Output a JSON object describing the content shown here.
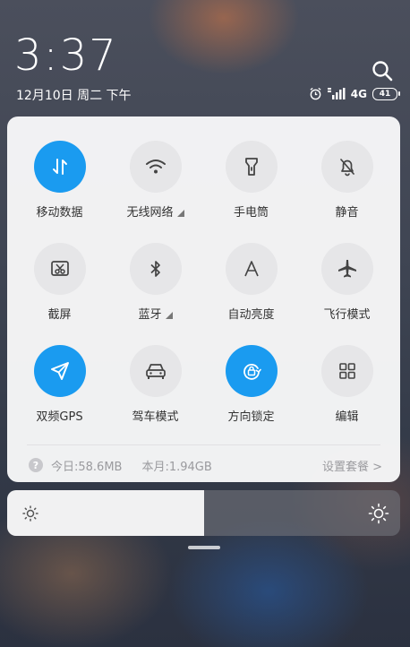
{
  "status": {
    "time": "3:37",
    "date": "12月10日 周二 下午",
    "network": "4G",
    "battery": "41"
  },
  "tiles": [
    {
      "label": "移动数据",
      "icon": "mobile-data-icon",
      "on": true
    },
    {
      "label": "无线网络",
      "icon": "wifi-icon",
      "on": false,
      "more": true
    },
    {
      "label": "手电筒",
      "icon": "flashlight-icon",
      "on": false
    },
    {
      "label": "静音",
      "icon": "bell-off-icon",
      "on": false
    },
    {
      "label": "截屏",
      "icon": "screenshot-icon",
      "on": false
    },
    {
      "label": "蓝牙",
      "icon": "bluetooth-icon",
      "on": false,
      "more": true
    },
    {
      "label": "自动亮度",
      "icon": "auto-brightness-icon",
      "on": false
    },
    {
      "label": "飞行模式",
      "icon": "airplane-icon",
      "on": false
    },
    {
      "label": "双频GPS",
      "icon": "gps-icon",
      "on": true
    },
    {
      "label": "驾车模式",
      "icon": "car-icon",
      "on": false
    },
    {
      "label": "方向锁定",
      "icon": "rotation-lock-icon",
      "on": true
    },
    {
      "label": "编辑",
      "icon": "edit-grid-icon",
      "on": false
    }
  ],
  "usage": {
    "today": "今日:58.6MB",
    "month": "本月:1.94GB",
    "settings": "设置套餐 >"
  },
  "brightness": {
    "level_percent": 50
  },
  "colors": {
    "accent": "#1a9bf0",
    "tile_off": "#e6e6e8"
  }
}
